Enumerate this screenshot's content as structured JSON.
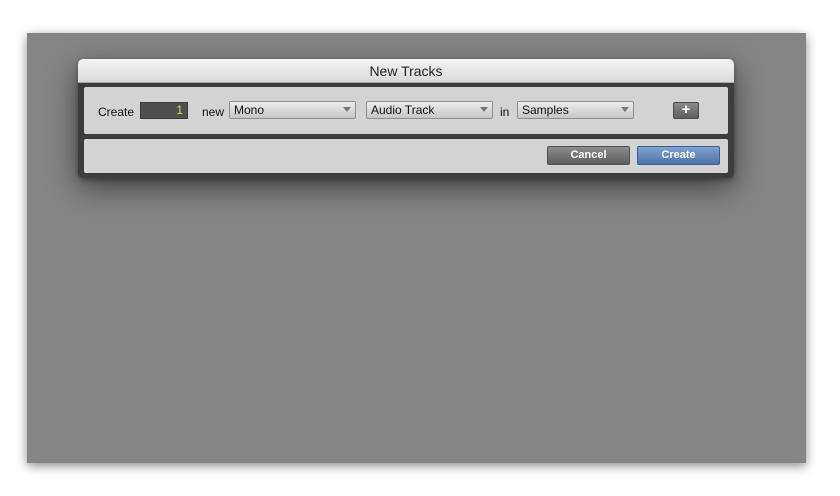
{
  "dialog": {
    "title": "New Tracks",
    "create_label": "Create",
    "count_value": "1",
    "new_label": "new",
    "format_selected": "Mono",
    "track_type_selected": "Audio Track",
    "in_label": "in",
    "timebase_selected": "Samples",
    "add_row_label": "+",
    "cancel_label": "Cancel",
    "create_button_label": "Create"
  },
  "icons": {
    "dropdown_arrow": "chevron-down-icon"
  },
  "colors": {
    "count_text": "#c9e24a",
    "create_button": "#5a80b6",
    "cancel_button": "#6e6e6e",
    "backdrop": "#858585"
  }
}
